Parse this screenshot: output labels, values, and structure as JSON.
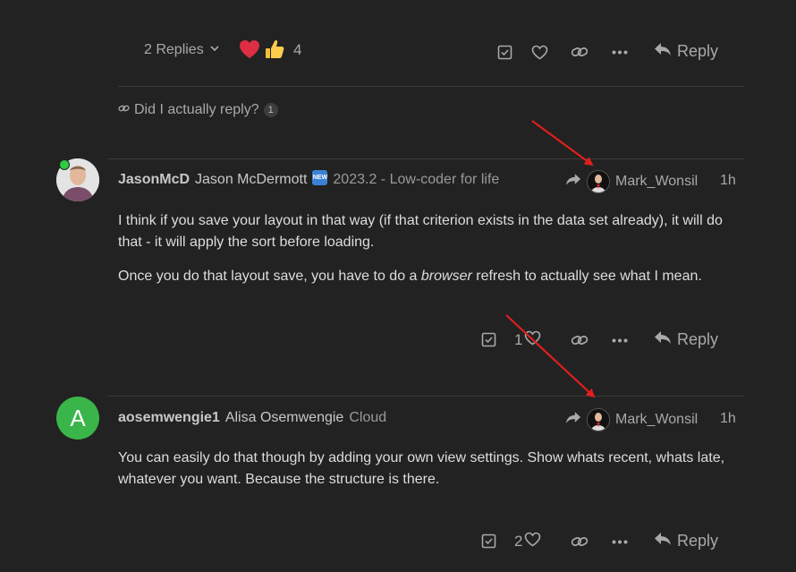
{
  "top_post": {
    "replies_label": "2 Replies",
    "reaction_count": "4",
    "reply_label": "Reply",
    "link_title": "Did I actually reply?",
    "link_count": "1"
  },
  "post1": {
    "username": "JasonMcD",
    "fullname": "Jason McDermott",
    "badge": "NEW",
    "user_title": "2023.2 - Low-coder for life",
    "reply_to": "Mark_Wonsil",
    "time": "1h",
    "paragraph1": "I think if you save your layout in that way (if that criterion exists in the data set already), it will do that - it will apply the sort before loading.",
    "p2_before": "Once you do that layout save, you have to do a ",
    "p2_em": "browser",
    "p2_after": " refresh to actually see what I mean.",
    "like_count": "1",
    "reply_label": "Reply"
  },
  "post2": {
    "avatar_letter": "A",
    "username": "aosemwengie1",
    "fullname": "Alisa Osemwengie",
    "user_title": "Cloud",
    "reply_to": "Mark_Wonsil",
    "time": "1h",
    "paragraph1": "You can easily do that though by adding your own view settings. Show whats recent, whats late, whatever you want. Because the structure is there.",
    "like_count": "2",
    "reply_label": "Reply"
  },
  "colors": {
    "background": "#222222",
    "text": "#dddddd",
    "muted": "#a9a9a9",
    "online": "#2ecc40",
    "avatar_green": "#3ab54a",
    "arrow": "#e01e1e"
  },
  "icons": [
    "chevron-down-icon",
    "heart-icon",
    "thumbs-up-icon",
    "check-square-icon",
    "link-icon",
    "more-icon",
    "reply-arrow-icon",
    "share-arrow-icon"
  ]
}
